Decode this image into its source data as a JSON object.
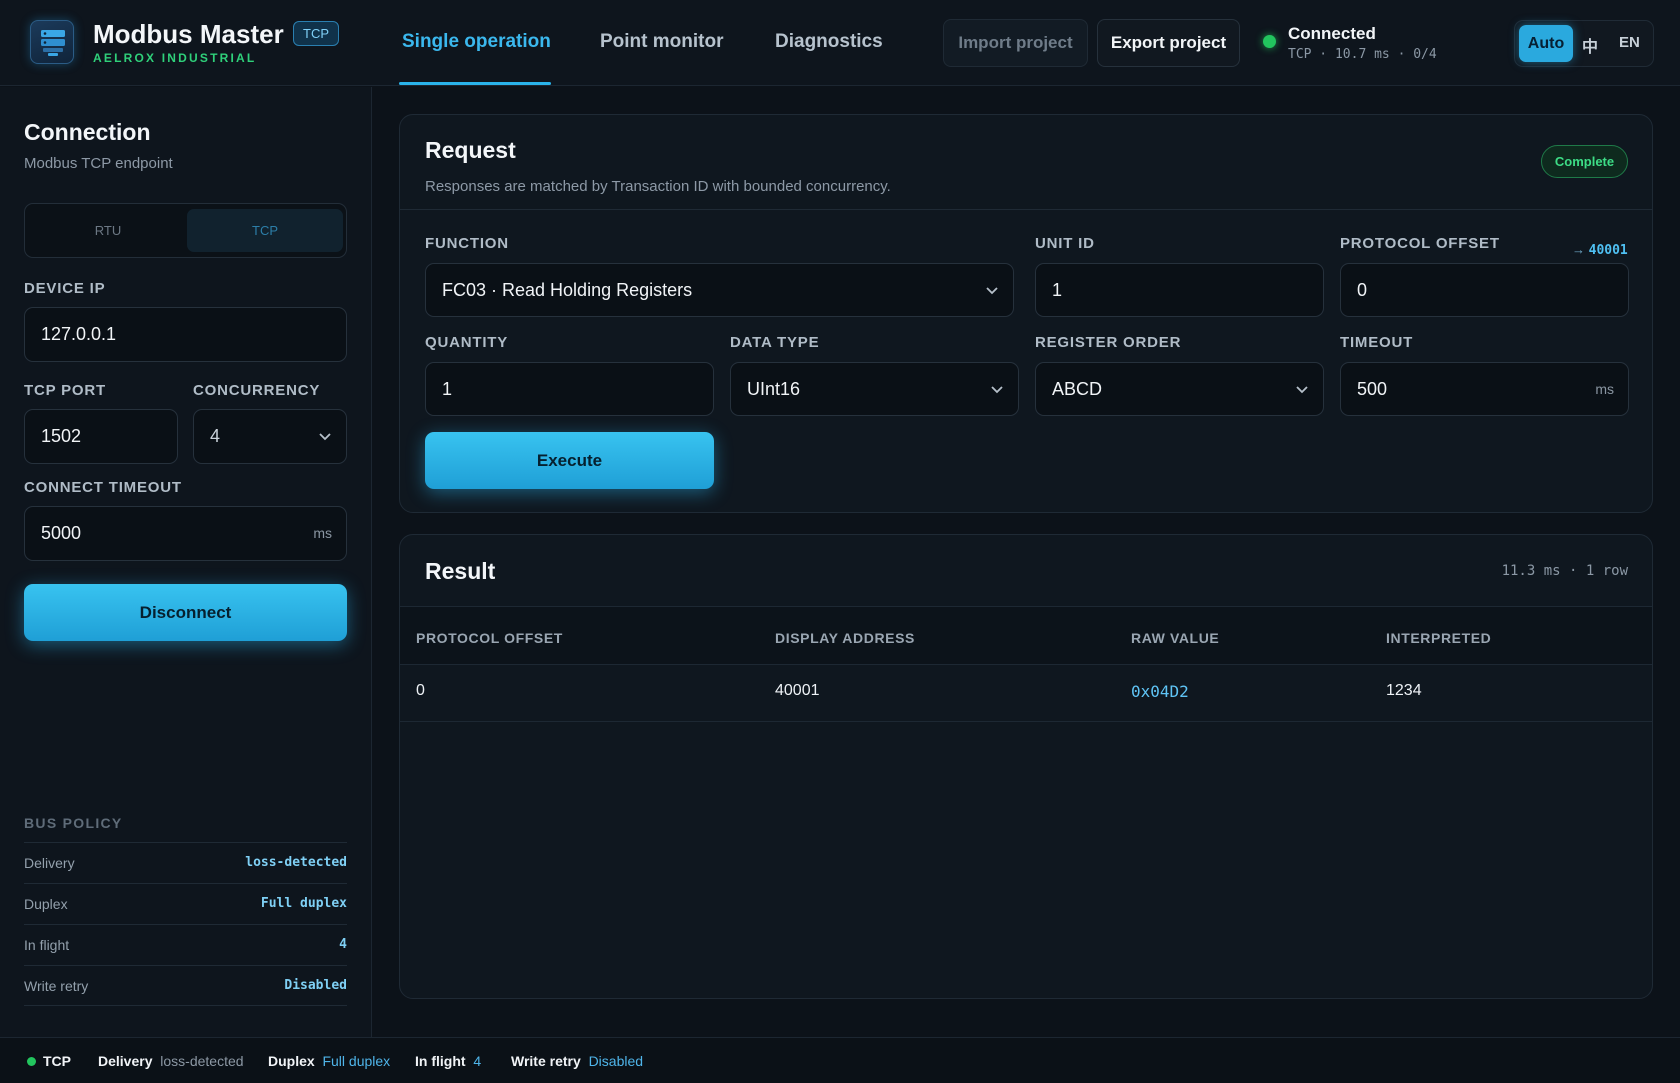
{
  "app": {
    "title": "Modbus Master",
    "protocol_tag": "TCP",
    "vendor": "AELROX INDUSTRIAL"
  },
  "nav": {
    "tabs": [
      {
        "label": "Single operation",
        "active": true
      },
      {
        "label": "Point monitor",
        "active": false
      },
      {
        "label": "Diagnostics",
        "active": false
      }
    ]
  },
  "header": {
    "import_label": "Import project",
    "export_label": "Export project",
    "status_title": "Connected",
    "status_detail": "TCP · 10.7 ms · 0/4",
    "lang": {
      "auto": "Auto",
      "zh": "中",
      "en": "EN"
    }
  },
  "sidebar": {
    "title": "Connection",
    "subtitle": "Modbus TCP endpoint",
    "modes": {
      "rtu": "RTU",
      "tcp": "TCP",
      "selected": "TCP"
    },
    "device_ip": {
      "label": "DEVICE IP",
      "value": "127.0.0.1"
    },
    "tcp_port": {
      "label": "TCP PORT",
      "value": "1502"
    },
    "concurrency": {
      "label": "CONCURRENCY",
      "value": "4"
    },
    "connect_timeout": {
      "label": "CONNECT TIMEOUT",
      "value": "5000",
      "unit": "ms"
    },
    "disconnect_label": "Disconnect",
    "policy": {
      "title": "BUS POLICY",
      "rows": [
        {
          "key": "Delivery",
          "value": "loss-detected"
        },
        {
          "key": "Duplex",
          "value": "Full duplex"
        },
        {
          "key": "In flight",
          "value": "4"
        },
        {
          "key": "Write retry",
          "value": "Disabled"
        }
      ]
    }
  },
  "request": {
    "title": "Request",
    "subtitle": "Responses are matched by Transaction ID with bounded concurrency.",
    "status_badge": "Complete",
    "function": {
      "label": "FUNCTION",
      "value": "FC03 · Read Holding Registers"
    },
    "unit_id": {
      "label": "UNIT ID",
      "value": "1"
    },
    "protocol_offset": {
      "label": "PROTOCOL OFFSET",
      "value": "0",
      "arrow": "→",
      "display": "40001"
    },
    "quantity": {
      "label": "QUANTITY",
      "value": "1"
    },
    "data_type": {
      "label": "DATA TYPE",
      "value": "UInt16"
    },
    "register_order": {
      "label": "REGISTER ORDER",
      "value": "ABCD"
    },
    "timeout": {
      "label": "TIMEOUT",
      "value": "500",
      "unit": "ms"
    },
    "execute_label": "Execute"
  },
  "result": {
    "title": "Result",
    "meta": "11.3 ms · 1 row",
    "columns": [
      "PROTOCOL OFFSET",
      "DISPLAY ADDRESS",
      "RAW VALUE",
      "INTERPRETED"
    ],
    "rows": [
      [
        "0",
        "40001",
        "0x04D2",
        "1234"
      ]
    ]
  },
  "footer": {
    "protocol": "TCP",
    "delivery_label": "Delivery",
    "delivery_value": "loss-detected",
    "duplex_label": "Duplex",
    "duplex_value": "Full duplex",
    "inflight_label": "In flight",
    "inflight_value": "4",
    "retry_label": "Write retry",
    "retry_value": "Disabled"
  },
  "colors": {
    "accent": "#2ab3ea",
    "connected": "#22c55e",
    "complete": "#3ddc86",
    "background": "#0c1219"
  },
  "icons": {
    "logo": "server-rack-icon",
    "select": "chevron-down-icon",
    "status": "status-dot-icon"
  }
}
